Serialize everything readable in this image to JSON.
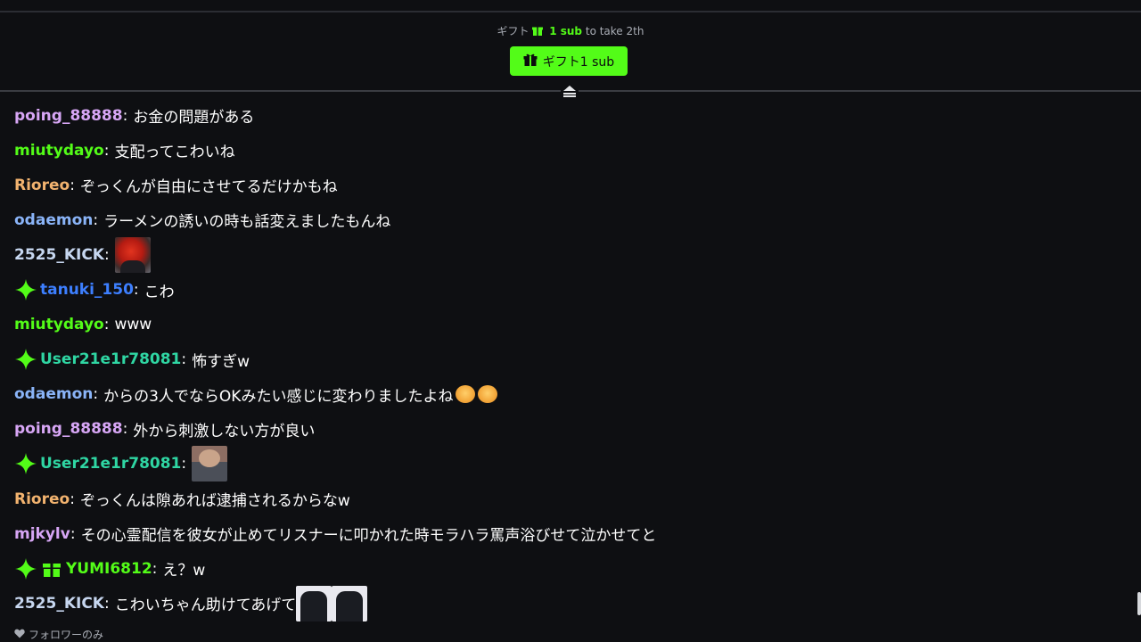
{
  "gift": {
    "banner_prefix": "ギフト",
    "banner_count": "1 sub",
    "banner_suffix": " to take 2th",
    "button_label": "ギフト1 sub"
  },
  "colors": {
    "accent": "#53fc18",
    "background": "#0e0f12"
  },
  "chat": {
    "messages": [
      {
        "username": "poing_88888",
        "user_color": "#d7a6f5",
        "text": "お金の問題がある",
        "badges": []
      },
      {
        "username": "miutydayo",
        "user_color": "#53fc18",
        "text": "支配ってこわいね",
        "badges": []
      },
      {
        "username": "Rioreo",
        "user_color": "#f2b36f",
        "text": "ぞっくんが自由にさせてるだけかもね",
        "badges": []
      },
      {
        "username": "odaemon",
        "user_color": "#8ab4f8",
        "text": "ラーメンの誘いの時も話変えましたもんね",
        "badges": []
      },
      {
        "username": "2525_KICK",
        "user_color": "#c7d7f0",
        "text": "",
        "badges": [],
        "emotes": [
          "red-emote"
        ]
      },
      {
        "username": "tanuki_150",
        "user_color": "#3d7fff",
        "text": "こわ",
        "badges": [
          "sparkle-badge"
        ]
      },
      {
        "username": "miutydayo",
        "user_color": "#53fc18",
        "text": "www",
        "badges": []
      },
      {
        "username": "User21e1r78081",
        "user_color": "#2fd6a3",
        "text": "怖すぎw",
        "badges": [
          "sparkle-badge"
        ]
      },
      {
        "username": "odaemon",
        "user_color": "#8ab4f8",
        "text": "からの3人でならOKみたい感じに変わりましたよね",
        "badges": [],
        "emotes": [
          "hug-emoji",
          "hug-emoji"
        ]
      },
      {
        "username": "poing_88888",
        "user_color": "#d7a6f5",
        "text": "外から刺激しない方が良い",
        "badges": []
      },
      {
        "username": "User21e1r78081",
        "user_color": "#2fd6a3",
        "text": "",
        "badges": [
          "sparkle-badge"
        ],
        "emotes": [
          "face-emote"
        ]
      },
      {
        "username": "Rioreo",
        "user_color": "#f2b36f",
        "text": "ぞっくんは隙あれば逮捕されるからなw",
        "badges": []
      },
      {
        "username": "mjkylv",
        "user_color": "#d7a6f5",
        "text": "その心霊配信を彼女が止めてリスナーに叩かれた時モラハラ罵声浴びせて泣かせてと",
        "badges": []
      },
      {
        "username": "YUMI6812",
        "user_color": "#53fc18",
        "text": "え？w",
        "badges": [
          "sparkle-badge",
          "gift-badge"
        ]
      },
      {
        "username": "2525_KICK",
        "user_color": "#c7d7f0",
        "text": "こわいちゃん助けてあげて",
        "badges": [],
        "emotes": [
          "shirt-emote",
          "shirt-emote"
        ]
      }
    ]
  },
  "footer": {
    "mode_label": "フォロワーのみ",
    "icon": "heart-icon"
  }
}
